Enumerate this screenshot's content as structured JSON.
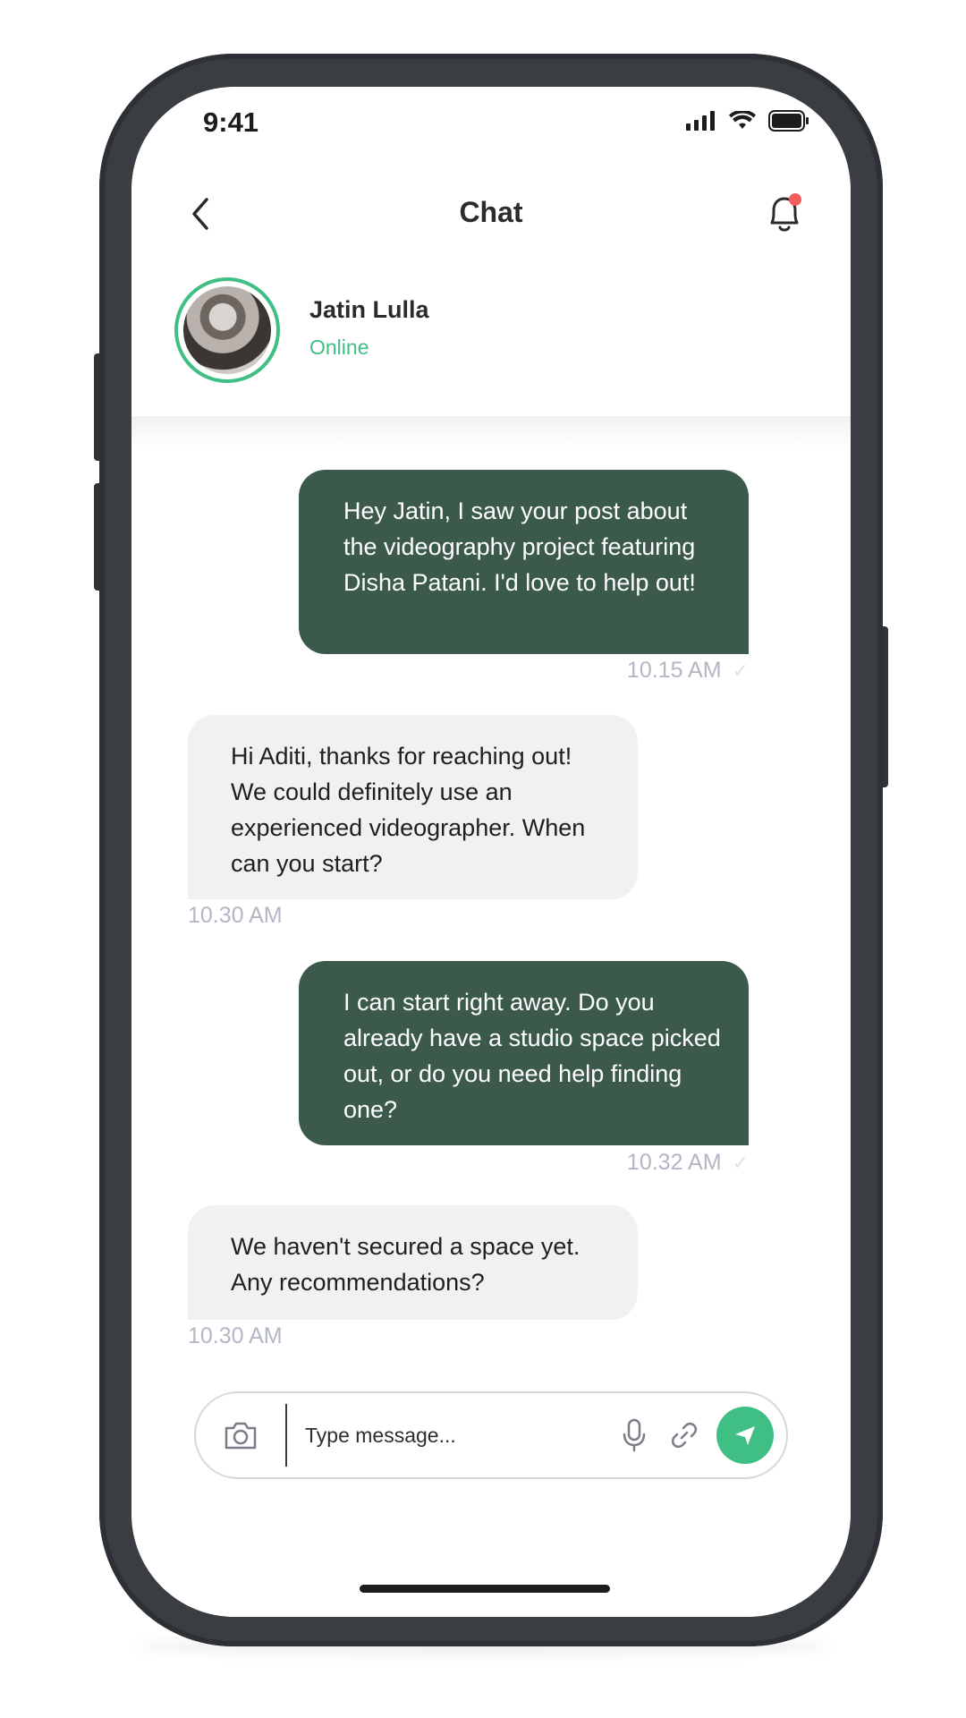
{
  "status_bar": {
    "time": "9:41"
  },
  "header": {
    "title": "Chat"
  },
  "contact": {
    "name": "Jatin Lulla",
    "status": "Online"
  },
  "messages": [
    {
      "side": "sent",
      "text": "Hey Jatin, I saw your post about the videography project featuring Disha Patani. I'd love to help out!",
      "time": "10.15 AM"
    },
    {
      "side": "recv",
      "text": "Hi Aditi, thanks for reaching out! We could definitely use an experienced videographer. When can you start?",
      "time": "10.30 AM"
    },
    {
      "side": "sent",
      "text": "I can start right away. Do you already have a studio space picked out, or do you need help finding one?",
      "time": "10.32 AM"
    },
    {
      "side": "recv",
      "text": "We haven't secured a space yet. Any recommendations?",
      "time": "10.30 AM"
    }
  ],
  "composer": {
    "placeholder": "Type message..."
  },
  "colors": {
    "accent": "#3fbf83",
    "sent_bubble": "#3b5a4b",
    "recv_bubble": "#f1f1f1",
    "notification_dot": "#f25d5d"
  },
  "icons": [
    "back-arrow-icon",
    "bell-icon",
    "camera-icon",
    "microphone-icon",
    "link-icon",
    "send-icon",
    "signal-icon",
    "wifi-icon",
    "battery-icon",
    "check-icon"
  ]
}
